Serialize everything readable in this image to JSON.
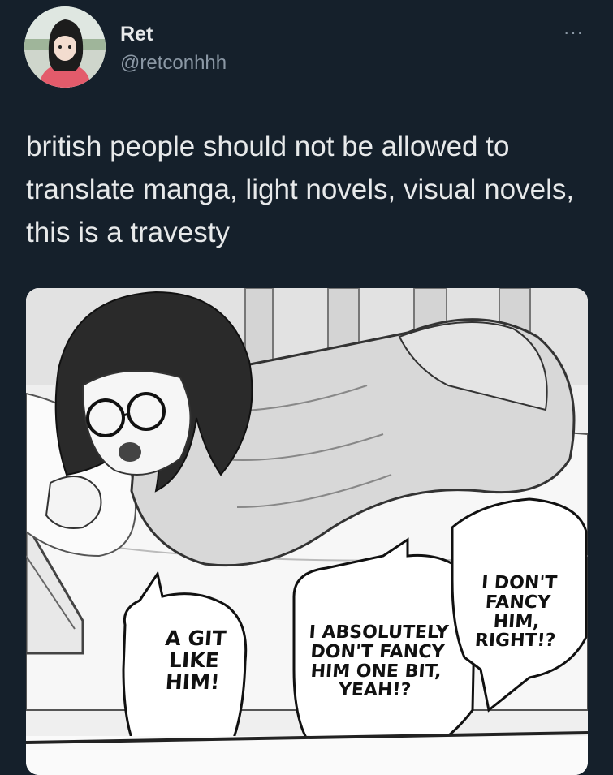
{
  "tweet": {
    "display_name": "Ret",
    "handle": "@retconhhh",
    "more_label": "···",
    "text": "british people should not be allowed to translate manga, light novels, visual novels, this is a travesty"
  },
  "media": {
    "speech_bubbles": [
      "A GIT\nLIKE\nHIM!",
      "I ABSOLUTELY\nDON'T FANCY\nHIM ONE BIT,\nYEAH!?",
      "I DON'T\nFANCY HIM,\nRIGHT!?"
    ]
  },
  "icons": {
    "more": "more-horizontal-icon"
  },
  "colors": {
    "background": "#15202b",
    "text_primary": "#e7e9ea",
    "text_secondary": "#8b98a5"
  }
}
